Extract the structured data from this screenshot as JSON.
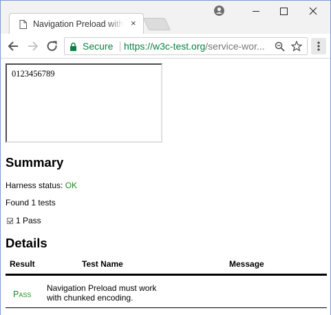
{
  "browser": {
    "tab_title": "Navigation Preload with chunked encoding",
    "tab_close": "×",
    "omnibox": {
      "secure_label": "Secure",
      "url_scheme_host": "https://w3c-test.org",
      "url_path": "/service-wor..."
    },
    "colors": {
      "secure_green": "#0b8043",
      "tabstrip": "#f2f2f2",
      "frame_border": "#7a9ad0"
    },
    "icons": [
      "page-icon",
      "profile-icon",
      "minimize-icon",
      "maximize-icon",
      "close-icon",
      "back-icon",
      "forward-icon",
      "reload-icon",
      "lock-icon",
      "zoom-icon",
      "star-icon",
      "menu-icon"
    ]
  },
  "page": {
    "frame_text": "0123456789",
    "summary": {
      "heading": "Summary",
      "harness_label": "Harness status: ",
      "harness_status": "OK",
      "found_text": "Found 1 tests",
      "pass_count_text": "1 Pass"
    },
    "details": {
      "heading": "Details",
      "columns": [
        "Result",
        "Test Name",
        "Message"
      ],
      "rows": [
        {
          "result": "Pass",
          "name": "Navigation Preload must work with chunked encoding.",
          "message": ""
        }
      ]
    },
    "colors": {
      "pass_green": "#188a18"
    }
  }
}
